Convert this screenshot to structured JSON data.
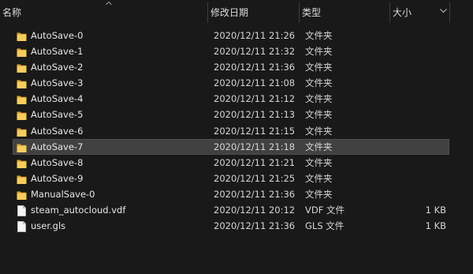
{
  "columns": {
    "name": "名称",
    "date": "修改日期",
    "type": "类型",
    "size": "大小"
  },
  "files": [
    {
      "name": "AutoSave-0",
      "date": "2020/12/11 21:26",
      "type": "文件夹",
      "size": "",
      "icon": "folder-icon"
    },
    {
      "name": "AutoSave-1",
      "date": "2020/12/11 21:32",
      "type": "文件夹",
      "size": "",
      "icon": "folder-icon"
    },
    {
      "name": "AutoSave-2",
      "date": "2020/12/11 21:36",
      "type": "文件夹",
      "size": "",
      "icon": "folder-icon"
    },
    {
      "name": "AutoSave-3",
      "date": "2020/12/11 21:08",
      "type": "文件夹",
      "size": "",
      "icon": "folder-icon"
    },
    {
      "name": "AutoSave-4",
      "date": "2020/12/11 21:12",
      "type": "文件夹",
      "size": "",
      "icon": "folder-icon"
    },
    {
      "name": "AutoSave-5",
      "date": "2020/12/11 21:13",
      "type": "文件夹",
      "size": "",
      "icon": "folder-icon"
    },
    {
      "name": "AutoSave-6",
      "date": "2020/12/11 21:15",
      "type": "文件夹",
      "size": "",
      "icon": "folder-icon"
    },
    {
      "name": "AutoSave-7",
      "date": "2020/12/11 21:18",
      "type": "文件夹",
      "size": "",
      "icon": "folder-icon",
      "selected": true
    },
    {
      "name": "AutoSave-8",
      "date": "2020/12/11 21:21",
      "type": "文件夹",
      "size": "",
      "icon": "folder-icon"
    },
    {
      "name": "AutoSave-9",
      "date": "2020/12/11 21:25",
      "type": "文件夹",
      "size": "",
      "icon": "folder-icon"
    },
    {
      "name": "ManualSave-0",
      "date": "2020/12/11 21:36",
      "type": "文件夹",
      "size": "",
      "icon": "folder-icon"
    },
    {
      "name": "steam_autocloud.vdf",
      "date": "2020/12/11 20:12",
      "type": "VDF 文件",
      "size": "1 KB",
      "icon": "file-icon"
    },
    {
      "name": "user.gls",
      "date": "2020/12/11 21:36",
      "type": "GLS 文件",
      "size": "1 KB",
      "icon": "file-icon"
    }
  ],
  "colors": {
    "background": "#191919",
    "selected_row": "#414141",
    "folder": "#f2c14e"
  }
}
